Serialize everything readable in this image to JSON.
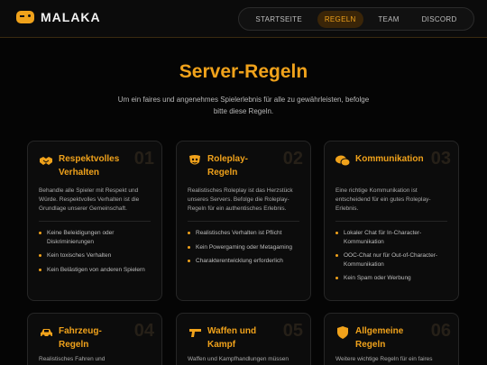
{
  "brand": {
    "name": "MALAKA"
  },
  "nav": [
    {
      "label": "STARTSEITE"
    },
    {
      "label": "REGELN"
    },
    {
      "label": "TEAM"
    },
    {
      "label": "DISCORD"
    }
  ],
  "hero": {
    "title": "Server-Regeln",
    "subtitle": "Um ein faires und angenehmes Spielerlebnis für alle zu gewährleisten, befolge bitte diese Regeln."
  },
  "cards": [
    {
      "icon": "handshake-icon",
      "title": "Respektvolles Verhalten",
      "number": "01",
      "desc": "Behandle alle Spieler mit Respekt und Würde. Respektvolles Verhalten ist die Grundlage unserer Gemeinschaft.",
      "items": [
        "Keine Beleidigungen oder Diskriminierungen",
        "Kein toxisches Verhalten",
        "Kein Belästigen von anderen Spielern"
      ]
    },
    {
      "icon": "theater-mask-icon",
      "title": "Roleplay-Regeln",
      "number": "02",
      "desc": "Realistisches Roleplay ist das Herzstück unseres Servers. Befolge die Roleplay-Regeln für ein authentisches Erlebnis.",
      "items": [
        "Realistisches Verhalten ist Pflicht",
        "Kein Powergaming oder Metagaming",
        "Charakterentwicklung erforderlich"
      ]
    },
    {
      "icon": "chat-bubbles-icon",
      "title": "Kommunikation",
      "number": "03",
      "desc": "Eine richtige Kommunikation ist entscheidend für ein gutes Roleplay-Erlebnis.",
      "items": [
        "Lokaler Chat für In-Character-Kommunikation",
        "OOC-Chat nur für Out-of-Character-Kommunikation",
        "Kein Spam oder Werbung"
      ]
    },
    {
      "icon": "car-icon",
      "title": "Fahrzeug-Regeln",
      "number": "04",
      "desc": "Realistisches Fahren und Fahrzeugnutzung sind wichtige Aspekte",
      "items": []
    },
    {
      "icon": "gun-icon",
      "title": "Waffen und Kampf",
      "number": "05",
      "desc": "Waffen und Kampfhandlungen müssen realistisch und gerechtfertigt sein.",
      "items": []
    },
    {
      "icon": "shield-icon",
      "title": "Allgemeine Regeln",
      "number": "06",
      "desc": "Weitere wichtige Regeln für ein faires Spielerlebnis.",
      "items": []
    }
  ],
  "colors": {
    "accent": "#f0a21b",
    "background": "#050505",
    "card": "#0c0c0c"
  }
}
